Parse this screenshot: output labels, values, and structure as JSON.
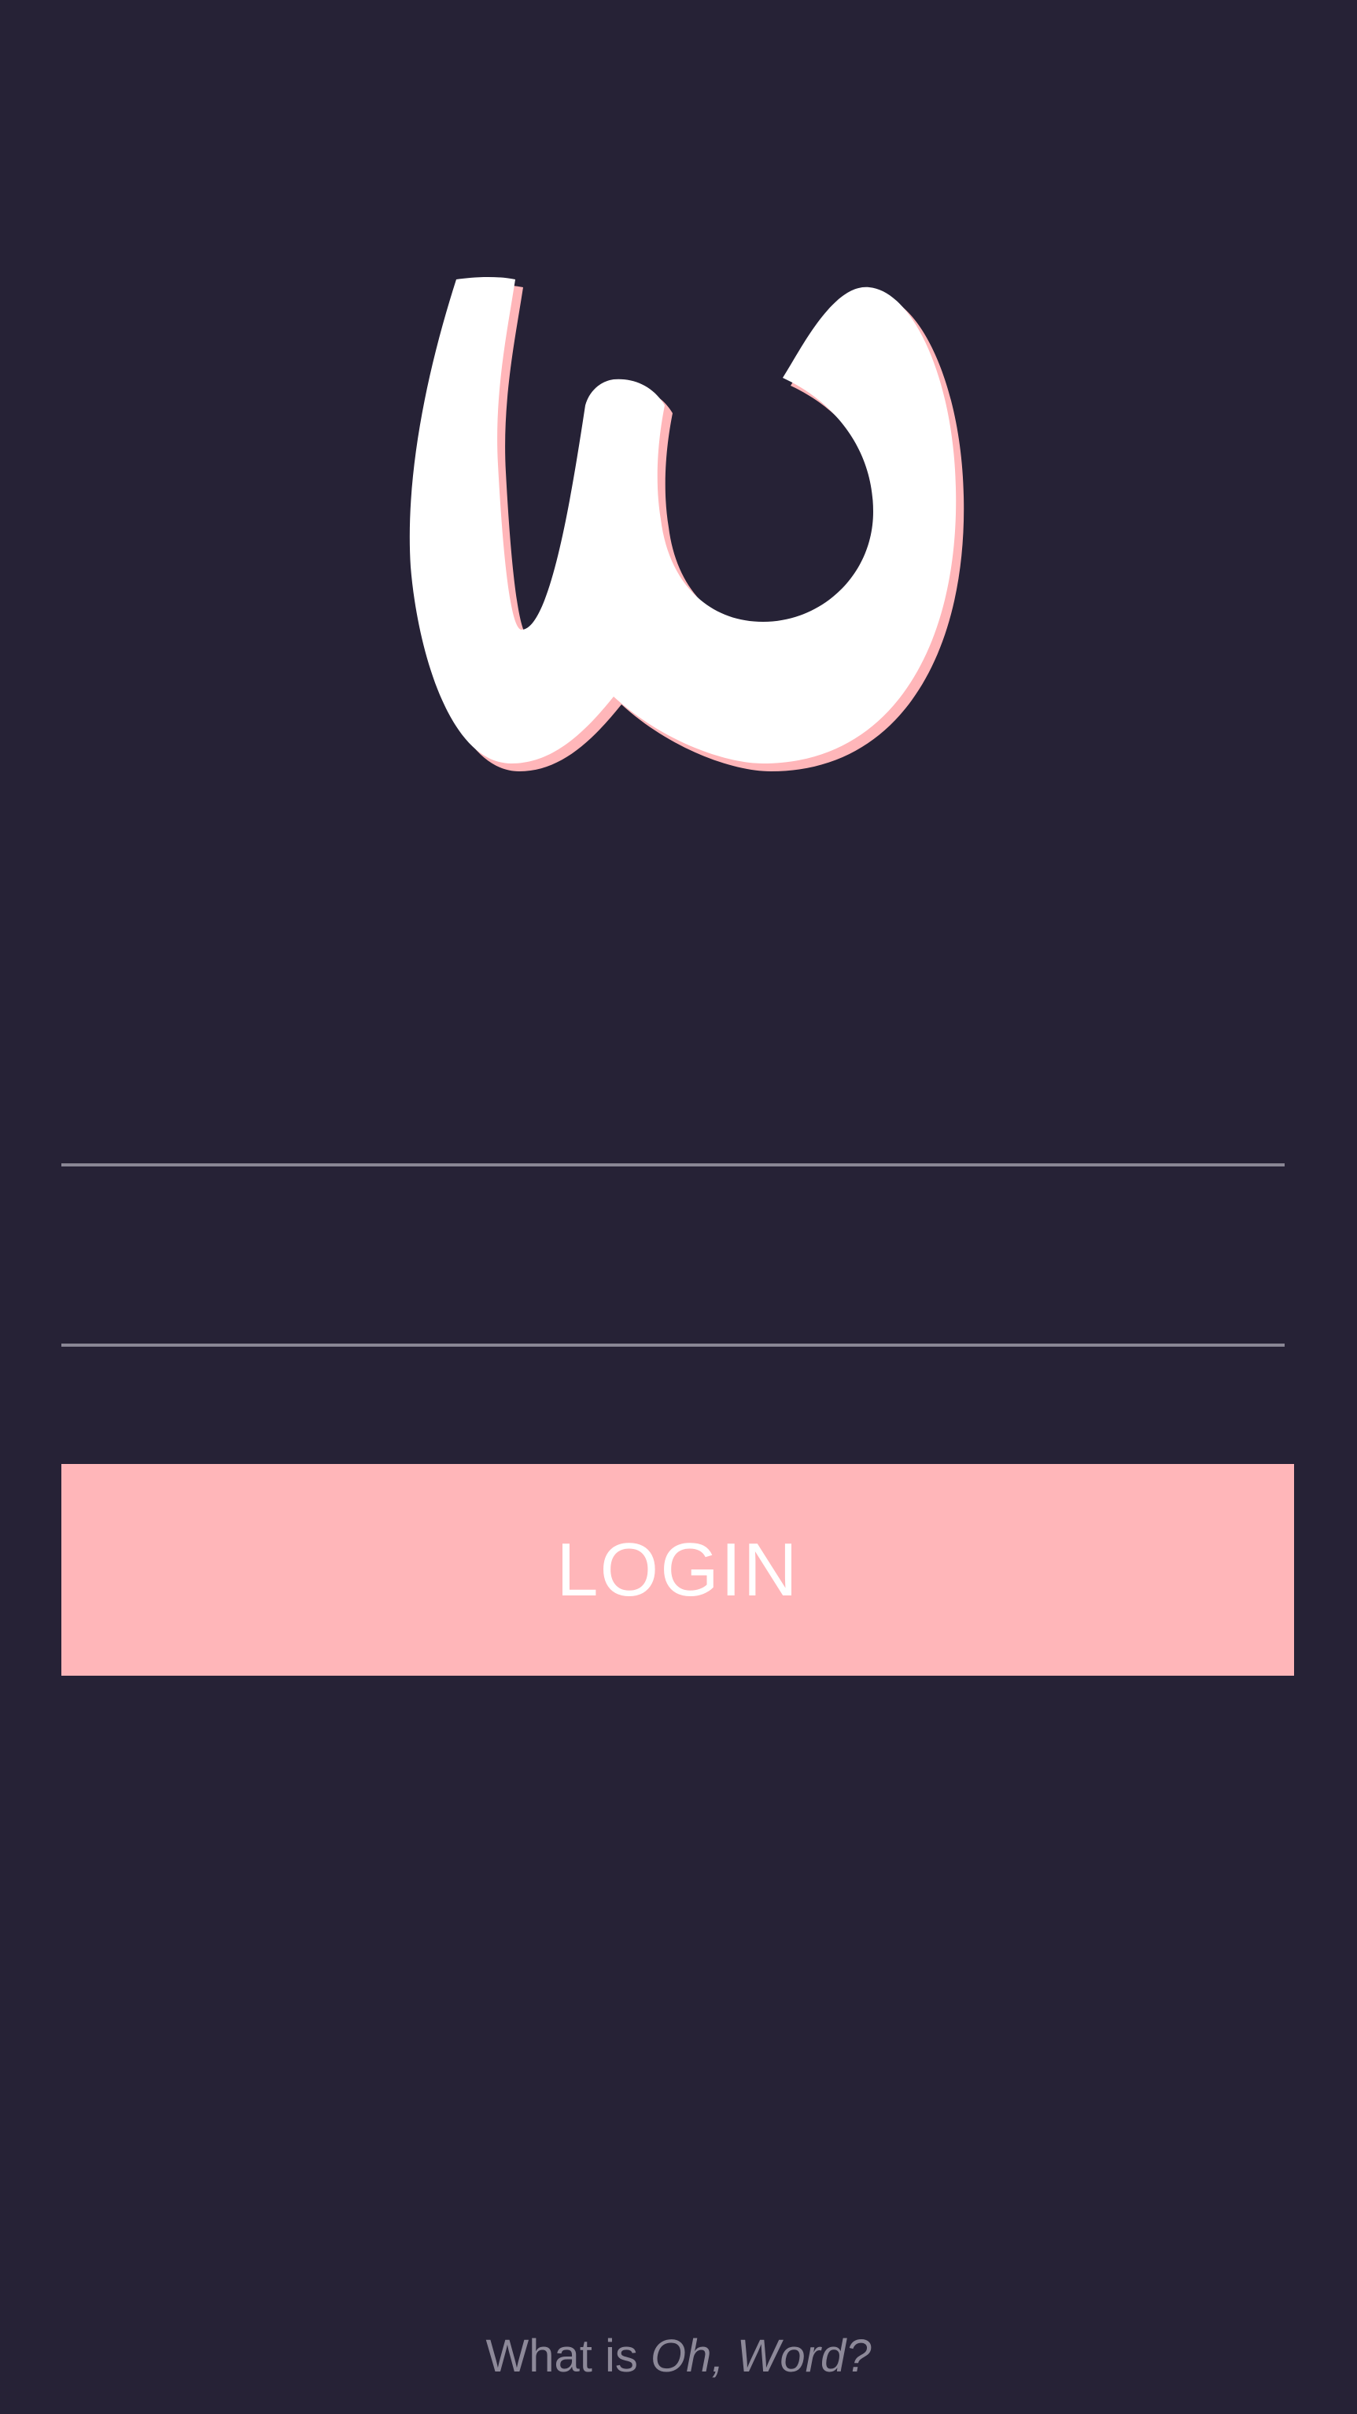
{
  "logo": {
    "icon": "oh-word-logo-icon",
    "colors": {
      "fill": "#ffffff",
      "shadow": "#ffb6b9"
    }
  },
  "form": {
    "username": {
      "value": "",
      "placeholder": ""
    },
    "password": {
      "value": "",
      "placeholder": ""
    },
    "login_label": "LOGIN"
  },
  "footer": {
    "prefix": "What is ",
    "brand": "Oh, Word?"
  },
  "colors": {
    "background": "#262236",
    "accent": "#ffb6b9",
    "muted": "#8d8999"
  }
}
